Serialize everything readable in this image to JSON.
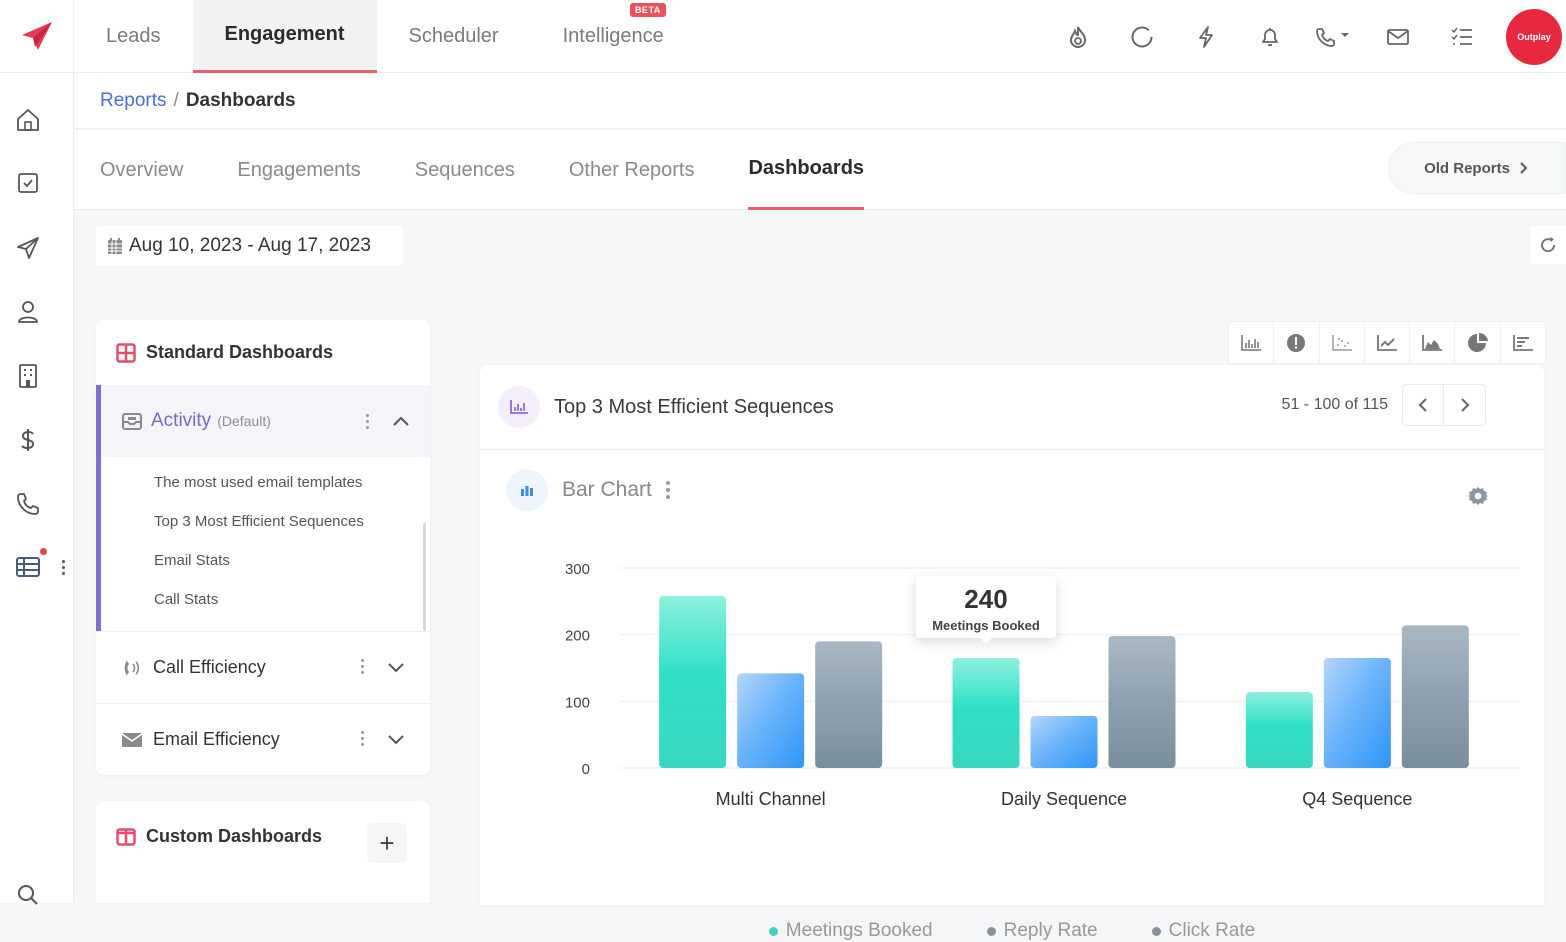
{
  "topnav": {
    "tabs": [
      {
        "label": "Leads",
        "active": false
      },
      {
        "label": "Engagement",
        "active": true
      },
      {
        "label": "Scheduler",
        "active": false
      },
      {
        "label": "Intelligence",
        "active": false,
        "badge": "BETA"
      }
    ],
    "icons": [
      "flame-icon",
      "circle-loader-icon",
      "lightning-icon",
      "bell-icon",
      "phone-dropdown-icon",
      "mail-icon",
      "checklist-icon"
    ],
    "avatar_label": "Outplay"
  },
  "sidebar": {
    "icons": [
      "home-icon",
      "tasks-icon",
      "send-icon",
      "user-icon",
      "building-icon",
      "dollar-icon",
      "phone-icon",
      "table-icon",
      "more-icon",
      "search-icon"
    ]
  },
  "breadcrumb": {
    "parent": "Reports",
    "separator": "/",
    "current": "Dashboards"
  },
  "subtabs": [
    {
      "label": "Overview",
      "active": false
    },
    {
      "label": "Engagements",
      "active": false
    },
    {
      "label": "Sequences",
      "active": false
    },
    {
      "label": "Other Reports",
      "active": false
    },
    {
      "label": "Dashboards",
      "active": true
    }
  ],
  "old_reports_label": "Old Reports",
  "date_range": "Aug 10, 2023 - Aug 17, 2023",
  "standard_dashboards": {
    "title": "Standard Dashboards",
    "activity": {
      "label": "Activity",
      "tag": "(Default)",
      "items": [
        "The most used email templates",
        "Top 3 Most Efficient Sequences",
        "Email Stats",
        "Call Stats"
      ]
    },
    "groups": [
      {
        "label": "Call Efficiency"
      },
      {
        "label": "Email Efficiency"
      }
    ]
  },
  "custom_dashboards": {
    "title": "Custom Dashboards",
    "add_label": "+"
  },
  "chart_type_toolbar": [
    "bar-chart-icon",
    "gauge-icon",
    "scatter-icon",
    "line-chart-icon",
    "area-chart-icon",
    "pie-chart-icon",
    "horizontal-bar-icon"
  ],
  "report_card": {
    "title": "Top 3 Most Efficient Sequences",
    "pagination": "51 - 100 of 115",
    "chart_label": "Bar Chart"
  },
  "tooltip": {
    "value": "240",
    "label": "Meetings Booked"
  },
  "colors": {
    "accent": "#e4606a",
    "brand": "#e8283f",
    "purple": "#7469c9",
    "teal": "#2fe0c6",
    "blue": "#3a9bf8",
    "grey": "#7f93a3"
  },
  "chart_data": {
    "type": "bar",
    "title": "Bar Chart",
    "categories": [
      "Multi Channel",
      "Daily Sequence",
      "Q4 Sequence"
    ],
    "series": [
      {
        "name": "Meetings Booked",
        "values": [
          258,
          165,
          114
        ],
        "color": "#2fe0c6"
      },
      {
        "name": "Reply Rate",
        "values": [
          142,
          78,
          165
        ],
        "color": "#3a9bf8"
      },
      {
        "name": "Click Rate",
        "values": [
          190,
          198,
          214
        ],
        "color": "#7f93a3"
      }
    ],
    "yticks": [
      0,
      100,
      200,
      300
    ],
    "ylim": [
      0,
      300
    ],
    "xlabel": "",
    "ylabel": "",
    "grid": true,
    "legend": "bottom-center",
    "legend_dot_colors": [
      "#3fd3bd",
      "#8a9099",
      "#8a9099"
    ]
  }
}
